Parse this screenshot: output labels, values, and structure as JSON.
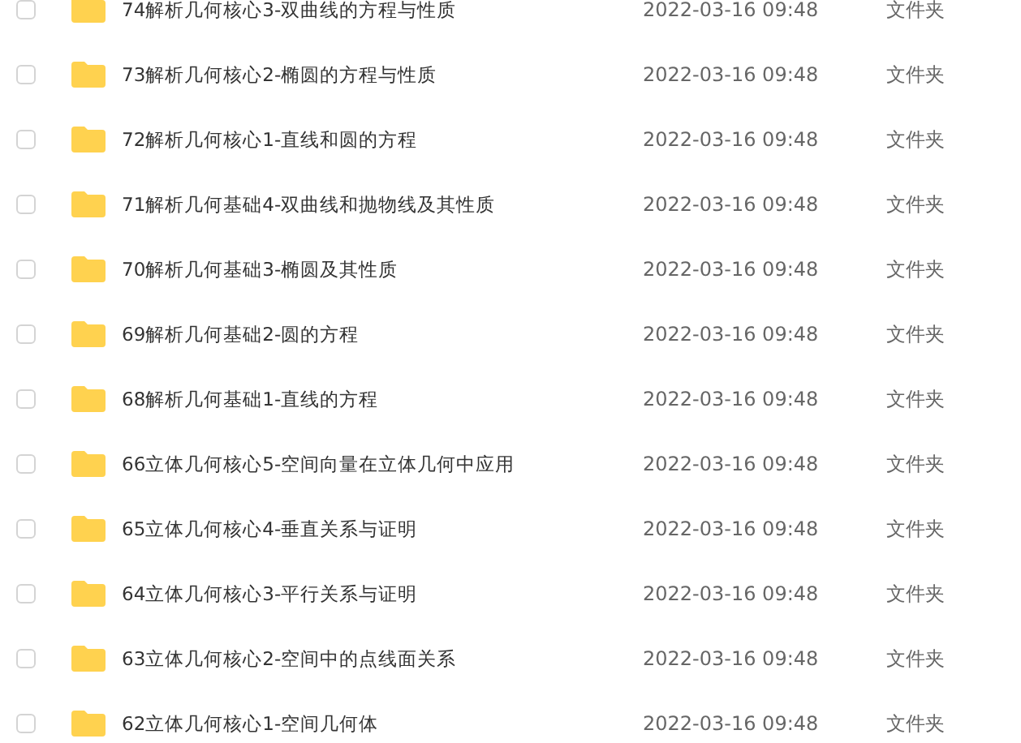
{
  "files": [
    {
      "name": "74解析几何核心3-双曲线的方程与性质",
      "modified": "2022-03-16 09:48",
      "type": "文件夹",
      "checked": false
    },
    {
      "name": "73解析几何核心2-椭圆的方程与性质",
      "modified": "2022-03-16 09:48",
      "type": "文件夹",
      "checked": false
    },
    {
      "name": "72解析几何核心1-直线和圆的方程",
      "modified": "2022-03-16 09:48",
      "type": "文件夹",
      "checked": false
    },
    {
      "name": "71解析几何基础4-双曲线和抛物线及其性质",
      "modified": "2022-03-16 09:48",
      "type": "文件夹",
      "checked": false
    },
    {
      "name": "70解析几何基础3-椭圆及其性质",
      "modified": "2022-03-16 09:48",
      "type": "文件夹",
      "checked": false
    },
    {
      "name": "69解析几何基础2-圆的方程",
      "modified": "2022-03-16 09:48",
      "type": "文件夹",
      "checked": false
    },
    {
      "name": "68解析几何基础1-直线的方程",
      "modified": "2022-03-16 09:48",
      "type": "文件夹",
      "checked": false
    },
    {
      "name": "66立体几何核心5-空间向量在立体几何中应用",
      "modified": "2022-03-16 09:48",
      "type": "文件夹",
      "checked": false
    },
    {
      "name": "65立体几何核心4-垂直关系与证明",
      "modified": "2022-03-16 09:48",
      "type": "文件夹",
      "checked": false
    },
    {
      "name": "64立体几何核心3-平行关系与证明",
      "modified": "2022-03-16 09:48",
      "type": "文件夹",
      "checked": false
    },
    {
      "name": "63立体几何核心2-空间中的点线面关系",
      "modified": "2022-03-16 09:48",
      "type": "文件夹",
      "checked": false
    },
    {
      "name": "62立体几何核心1-空间几何体",
      "modified": "2022-03-16 09:48",
      "type": "文件夹",
      "checked": false
    }
  ]
}
